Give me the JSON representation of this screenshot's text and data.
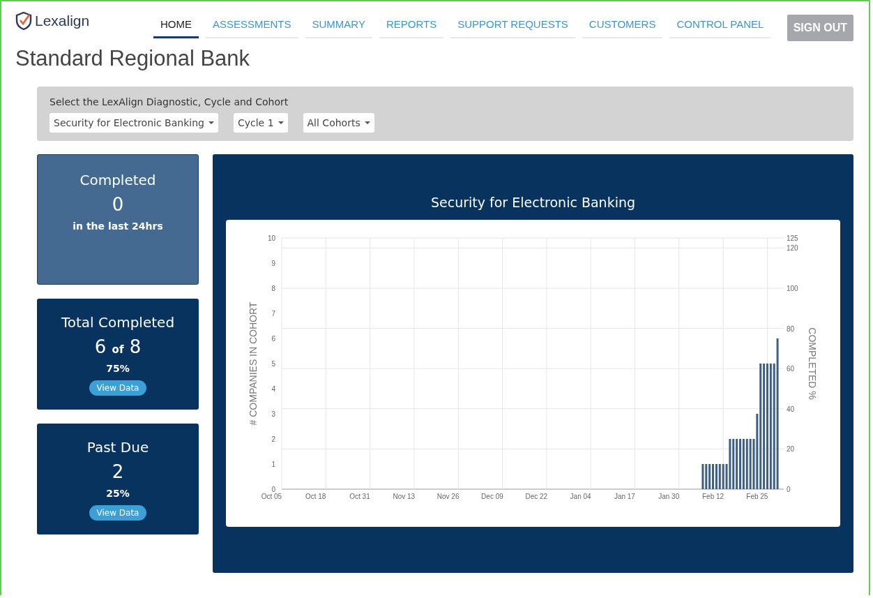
{
  "header": {
    "logo_text": "Lexalign",
    "nav": [
      {
        "label": "HOME",
        "selected": true
      },
      {
        "label": "ASSESSMENTS",
        "selected": false
      },
      {
        "label": "SUMMARY",
        "selected": false
      },
      {
        "label": "REPORTS",
        "selected": false
      },
      {
        "label": "SUPPORT REQUESTS",
        "selected": false
      },
      {
        "label": "CUSTOMERS",
        "selected": false
      },
      {
        "label": "CONTROL PANEL",
        "selected": false
      }
    ],
    "sign_out": "SIGN OUT"
  },
  "page_title": "Standard Regional Bank",
  "filters": {
    "label": "Select the LexAlign Diagnostic, Cycle and Cohort",
    "dropdowns": [
      {
        "value": "Security for Electronic Banking"
      },
      {
        "value": "Cycle 1"
      },
      {
        "value": "All Cohorts"
      }
    ]
  },
  "cards": [
    {
      "kind": "recent",
      "selected": true,
      "title": "Completed",
      "value": "0",
      "note": "in the last 24hrs"
    },
    {
      "kind": "total",
      "selected": false,
      "title": "Total Completed",
      "value": "6",
      "of": "of",
      "total": "8",
      "note": "75%",
      "button": "View Data"
    },
    {
      "kind": "simple",
      "selected": false,
      "title": "Past Due",
      "value": "2",
      "note": "25%",
      "button": "View Data"
    }
  ],
  "chart_panel": {
    "title": "Security for Electronic Banking",
    "chart_data": {
      "type": "bar",
      "ylabel": "COMPLETED %",
      "y2label": "# COMPANIES IN COHORT",
      "categories": [
        "Oct 05",
        null,
        null,
        null,
        null,
        null,
        null,
        null,
        null,
        null,
        null,
        null,
        null,
        "Oct 18",
        null,
        null,
        null,
        null,
        null,
        null,
        null,
        null,
        null,
        null,
        null,
        null,
        "Oct 31",
        null,
        null,
        null,
        null,
        null,
        null,
        null,
        null,
        null,
        null,
        null,
        null,
        "Nov 13",
        null,
        null,
        null,
        null,
        null,
        null,
        null,
        null,
        null,
        null,
        null,
        null,
        "Nov 26",
        null,
        null,
        null,
        null,
        null,
        null,
        null,
        null,
        null,
        null,
        null,
        null,
        "Dec 09",
        null,
        null,
        null,
        null,
        null,
        null,
        null,
        null,
        null,
        null,
        null,
        null,
        "Dec 22",
        null,
        null,
        null,
        null,
        null,
        null,
        null,
        null,
        null,
        null,
        null,
        null,
        "Jan 04",
        null,
        null,
        null,
        null,
        null,
        null,
        null,
        null,
        null,
        null,
        null,
        null,
        "Jan 17",
        null,
        null,
        null,
        null,
        null,
        null,
        null,
        null,
        null,
        null,
        null,
        null,
        "Jan 30",
        null,
        null,
        null,
        null,
        null,
        null,
        null,
        null,
        null,
        null,
        null,
        null,
        "Feb 12",
        null,
        null,
        null,
        null,
        null,
        null,
        null,
        null,
        null,
        null,
        null,
        null,
        "Feb 25",
        null,
        null,
        null,
        null,
        null,
        null
      ],
      "grid": true,
      "series": [
        {
          "color": "#3d5f86",
          "values": [
            null,
            null,
            null,
            null,
            null,
            null,
            null,
            null,
            null,
            null,
            null,
            null,
            null,
            null,
            null,
            null,
            null,
            null,
            null,
            null,
            null,
            null,
            null,
            null,
            null,
            null,
            null,
            null,
            null,
            null,
            null,
            null,
            null,
            null,
            null,
            null,
            null,
            null,
            null,
            null,
            null,
            null,
            null,
            null,
            null,
            null,
            null,
            null,
            null,
            null,
            null,
            null,
            null,
            null,
            null,
            null,
            null,
            null,
            null,
            null,
            null,
            null,
            null,
            null,
            null,
            null,
            null,
            null,
            null,
            null,
            null,
            null,
            null,
            null,
            null,
            null,
            null,
            null,
            null,
            null,
            null,
            null,
            null,
            null,
            null,
            null,
            null,
            null,
            null,
            null,
            null,
            null,
            null,
            null,
            null,
            null,
            null,
            null,
            null,
            null,
            null,
            null,
            null,
            null,
            null,
            null,
            null,
            null,
            null,
            null,
            null,
            null,
            null,
            null,
            null,
            null,
            null,
            null,
            null,
            null,
            null,
            null,
            null,
            null,
            null,
            null,
            null,
            12.5,
            12.5,
            12.5,
            12.5,
            12.5,
            12.5,
            12.5,
            12.5,
            25,
            25,
            25,
            25,
            25,
            25,
            25,
            25,
            37.5,
            62.5,
            62.5,
            62.5,
            62.5,
            62.5,
            75
          ]
        }
      ],
      "ylim": [
        0,
        125
      ],
      "yticks": [
        0,
        20,
        40,
        60,
        80,
        100,
        120,
        125
      ],
      "y2lim": [
        0,
        10
      ],
      "y2ticks": [
        0,
        1,
        2,
        3,
        4,
        5,
        6,
        7,
        8,
        9,
        10
      ]
    }
  }
}
